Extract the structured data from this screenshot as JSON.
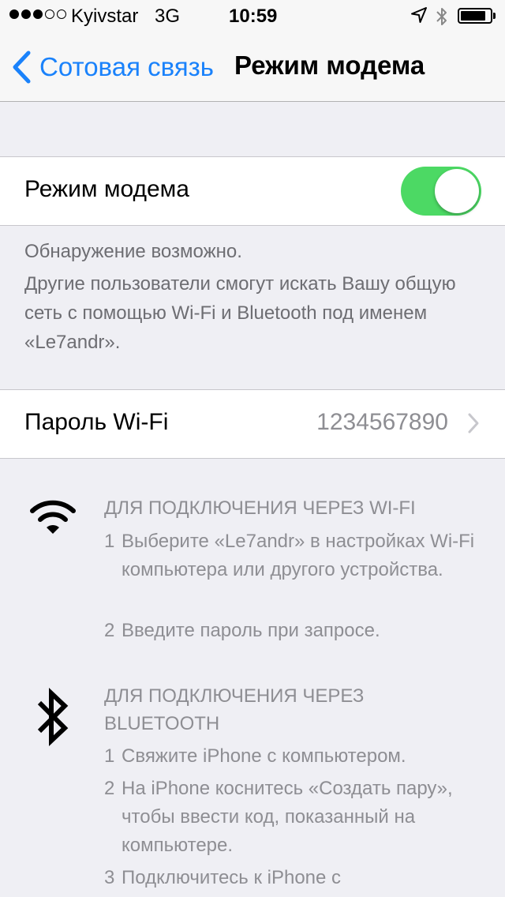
{
  "status_bar": {
    "carrier": "Kyivstar",
    "network": "3G",
    "time": "10:59",
    "battery_level": 0.85,
    "signal_bars_filled": 3,
    "signal_bars_total": 5
  },
  "nav": {
    "back_label": "Сотовая связь",
    "title": "Режим модема",
    "accent_color": "#1a82fb"
  },
  "hotspot": {
    "label": "Режим модема",
    "enabled": true,
    "toggle_color": "#4cd964"
  },
  "discoverable_note": {
    "line1": "Обнаружение возможно.",
    "line2": "Другие пользователи смогут искать Вашу общую сеть с помощью Wi-Fi и Bluetooth под именем «Le7andr»."
  },
  "wifi_password": {
    "label": "Пароль Wi-Fi",
    "value": "1234567890"
  },
  "wifi_instructions": {
    "title": "ДЛЯ ПОДКЛЮЧЕНИЯ ЧЕРЕЗ WI-FI",
    "steps": [
      {
        "num": "1",
        "text": "Выберите «Le7andr» в настройках Wi-Fi компьютера или другого устройства."
      },
      {
        "num": "2",
        "text": "Введите пароль при запросе."
      }
    ]
  },
  "bluetooth_instructions": {
    "title": "ДЛЯ ПОДКЛЮЧЕНИЯ ЧЕРЕЗ BLUETOOTH",
    "steps": [
      {
        "num": "1",
        "text": "Свяжите iPhone с компьютером."
      },
      {
        "num": "2",
        "text": "На iPhone коснитесь «Создать пару», чтобы ввести код, показанный на компьютере."
      },
      {
        "num": "3",
        "text": "Подключитесь к iPhone с"
      }
    ]
  }
}
